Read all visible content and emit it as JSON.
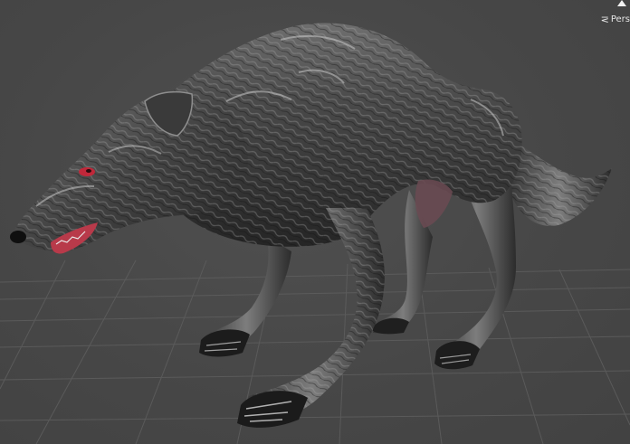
{
  "scene_view": {
    "projection_label": "Pers",
    "projection_icon": "perspective-chevron-icon",
    "gizmo_icon": "scene-gizmo-cone-icon",
    "object_icon": "wolf-model",
    "colors": {
      "background": "#474747",
      "grid": "#5c5c5c",
      "fur_dark": "#2b2b2b",
      "fur_light": "#8a8a8a",
      "eye": "#c0283a",
      "mouth": "#b83a4a"
    }
  }
}
